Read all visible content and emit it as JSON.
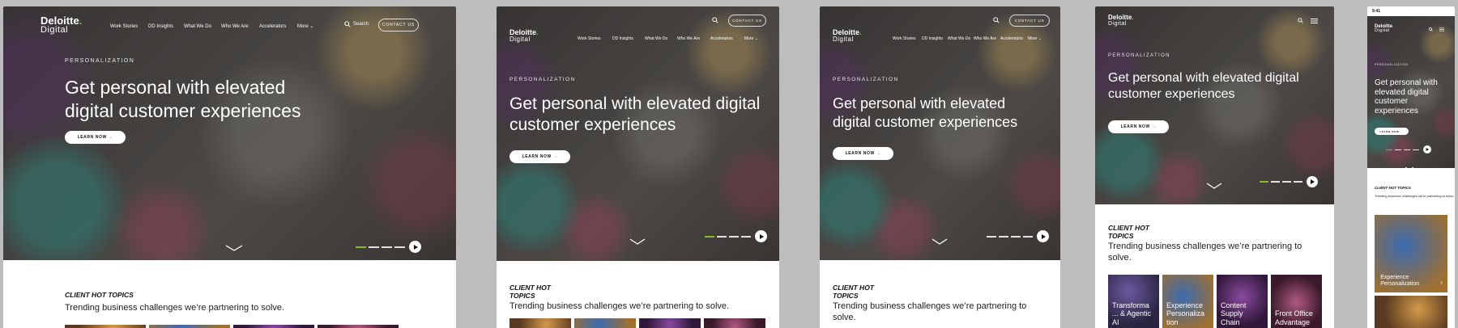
{
  "brand": {
    "name": "Deloitte",
    "dot": ".",
    "sub": "Digital",
    "accent": "#86bc25"
  },
  "nav": {
    "items": [
      "Work Stories",
      "DD Insights",
      "What We Do",
      "Who We Are",
      "Accelerators"
    ],
    "more": "More",
    "search": "Search",
    "contact": "CONTACT US"
  },
  "hero": {
    "eyebrow": "PERSONALIZATION",
    "headline": "Get personal with elevated digital customer experiences",
    "cta": "LEARN NOW"
  },
  "topics": {
    "title_line1": "CLIENT HOT",
    "title_line2": "TOPICS",
    "title_full": "CLIENT HOT TOPICS",
    "subtitle": "Trending business challenges we’re partnering to solve.",
    "tiles": [
      "Transforma ... & Agentic AI",
      "Experience Personaliza tion",
      "Content Supply Chain",
      "Front Office Advantage"
    ],
    "mobile_tile": "Experience Personalization"
  },
  "phone": {
    "time": "9:41"
  },
  "icons": {
    "search": "search-icon",
    "menu": "hamburger-menu-icon",
    "play": "play-icon",
    "chevron": "chevron-down-icon",
    "arrow": "arrow-right-icon"
  }
}
